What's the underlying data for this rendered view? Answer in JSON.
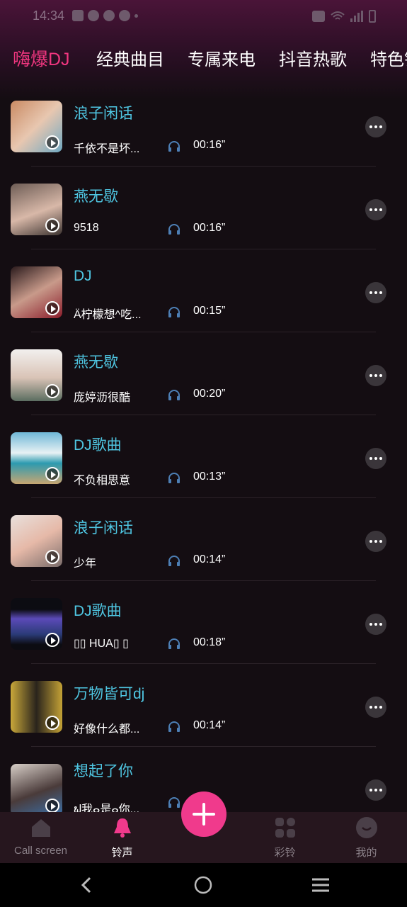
{
  "status_bar": {
    "time": "14:34"
  },
  "tabs": [
    "嗨爆DJ",
    "经典曲目",
    "专属来电",
    "抖音热歌",
    "特色铃"
  ],
  "songs": [
    {
      "title": "浪子闲话",
      "subtitle": "千依不是坏...",
      "duration": "00:16”"
    },
    {
      "title": "燕无歇",
      "subtitle": "9518",
      "duration": "00:16”"
    },
    {
      "title": "DJ",
      "subtitle": "Ä柠檬想^吃...",
      "duration": "00:15”"
    },
    {
      "title": "燕无歇",
      "subtitle": "庞婷沥很酷",
      "duration": "00:20”"
    },
    {
      "title": "DJ歌曲",
      "subtitle": "不负相思意",
      "duration": "00:13”"
    },
    {
      "title": "浪子闲话",
      "subtitle": "少年",
      "duration": "00:14”"
    },
    {
      "title": "DJ歌曲",
      "subtitle": "▯▯ HUA▯ ▯",
      "duration": "00:18”"
    },
    {
      "title": "万物皆可dj",
      "subtitle": "好像什么都...",
      "duration": "00:14”"
    },
    {
      "title": "想起了你",
      "subtitle": "ຟ我ⴰ是ⴰ你...",
      "duration": ""
    }
  ],
  "bottom_nav": [
    "Call screen",
    "铃声",
    "",
    "彩铃",
    "我的"
  ],
  "colors": {
    "accent_pink": "#f0367f",
    "title_cyan": "#4fc6e2",
    "fab": "#f03a8c"
  },
  "icons": {
    "play": "play-icon",
    "headphones": "headphones-icon",
    "more": "more-icon",
    "add": "plus-icon"
  }
}
